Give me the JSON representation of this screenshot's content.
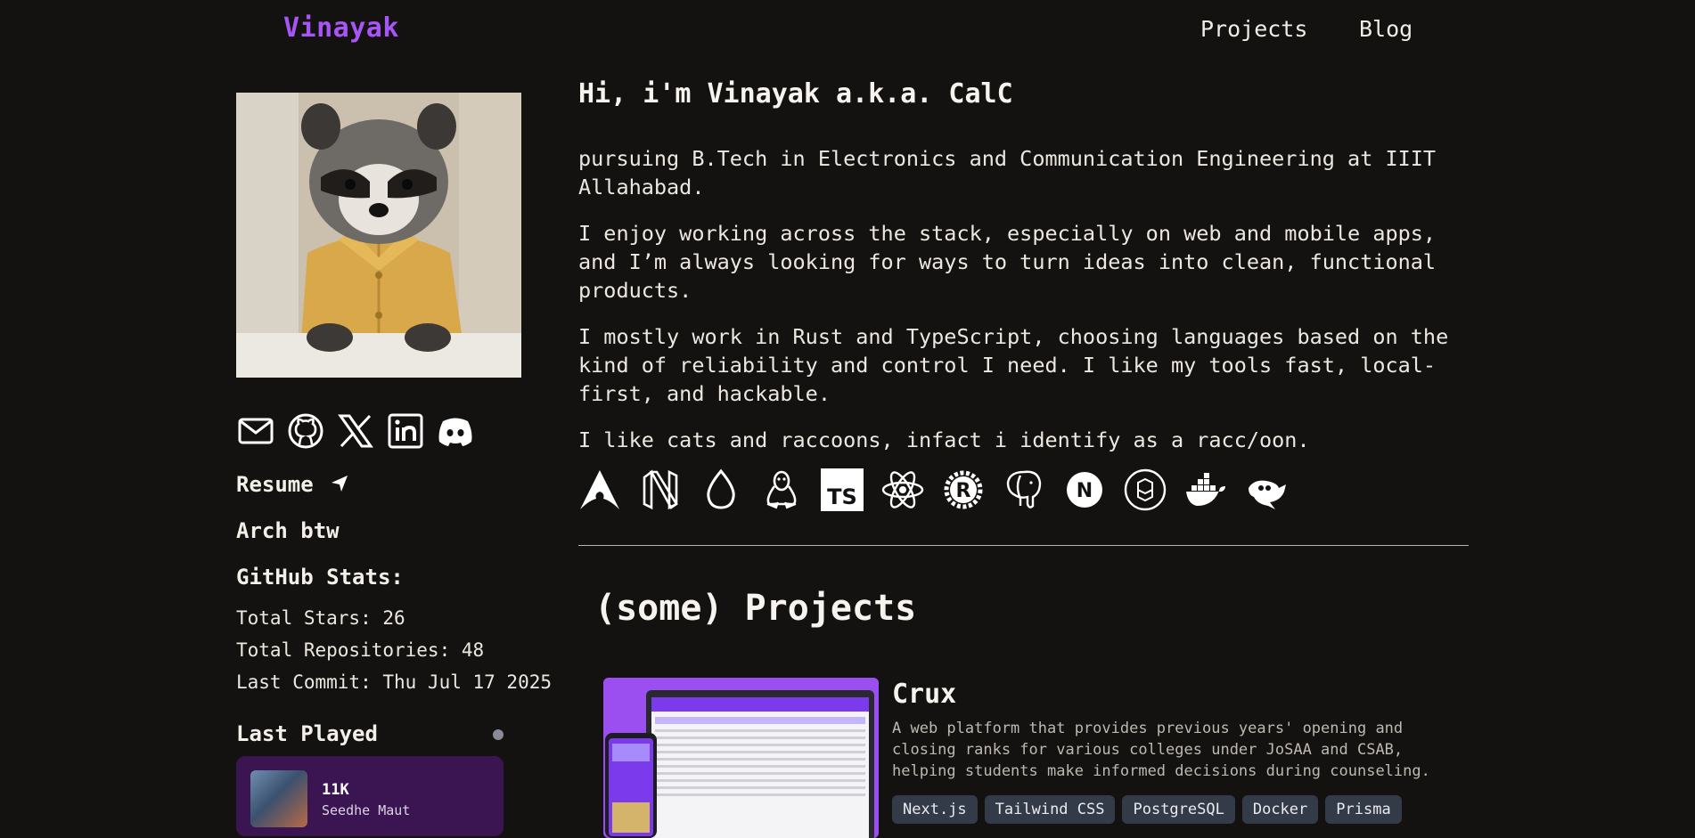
{
  "nav": {
    "brand": "Vinayak",
    "links": [
      "Projects",
      "Blog"
    ]
  },
  "sidebar": {
    "socials": [
      "mail-icon",
      "github-icon",
      "x-icon",
      "linkedin-icon",
      "discord-icon"
    ],
    "resume_label": "Resume",
    "arch_label": "Arch btw",
    "github_title": "GitHub Stats:",
    "stars": "Total Stars: 26",
    "repos": "Total Repositories: 48",
    "last_commit": "Last Commit: Thu Jul 17 2025",
    "last_played": {
      "title": "Last Played",
      "track": "11K",
      "artist": "Seedhe Maut"
    }
  },
  "intro": {
    "heading": "Hi, i'm Vinayak a.k.a. CalC",
    "paragraphs": [
      "pursuing B.Tech in Electronics and Communication Engineering at IIIT Allahabad.",
      "I enjoy working across the stack, especially on web and mobile apps, and I’m always looking for ways to turn ideas into clean, functional products.",
      "I mostly work in Rust and TypeScript, choosing languages based on the kind of reliability and control I need. I like my tools fast, local-first, and hackable.",
      "I like cats and raccoons, infact i identify as a racc/oon."
    ],
    "tech_icons": [
      "arch-linux-icon",
      "neovim-icon",
      "drop-icon",
      "linux-tux-icon",
      "typescript-icon",
      "react-icon",
      "rust-icon",
      "postgresql-icon",
      "nextjs-icon",
      "package-icon",
      "docker-icon",
      "gimp-icon"
    ],
    "tech_labels": {
      "typescript": "TS",
      "rust": "R",
      "nextjs": "N"
    }
  },
  "projects": {
    "title": "(some) Projects",
    "items": [
      {
        "name": "Crux",
        "description": "A web platform that provides previous years' opening and closing ranks for various colleges under JoSAA and CSAB, helping students make informed decisions during counseling.",
        "tags": [
          "Next.js",
          "Tailwind CSS",
          "PostgreSQL",
          "Docker",
          "Prisma"
        ]
      }
    ]
  },
  "colors": {
    "background": "#141210",
    "accent": "#a855f7",
    "tag_bg": "#343b48",
    "card": "#3b1552"
  }
}
